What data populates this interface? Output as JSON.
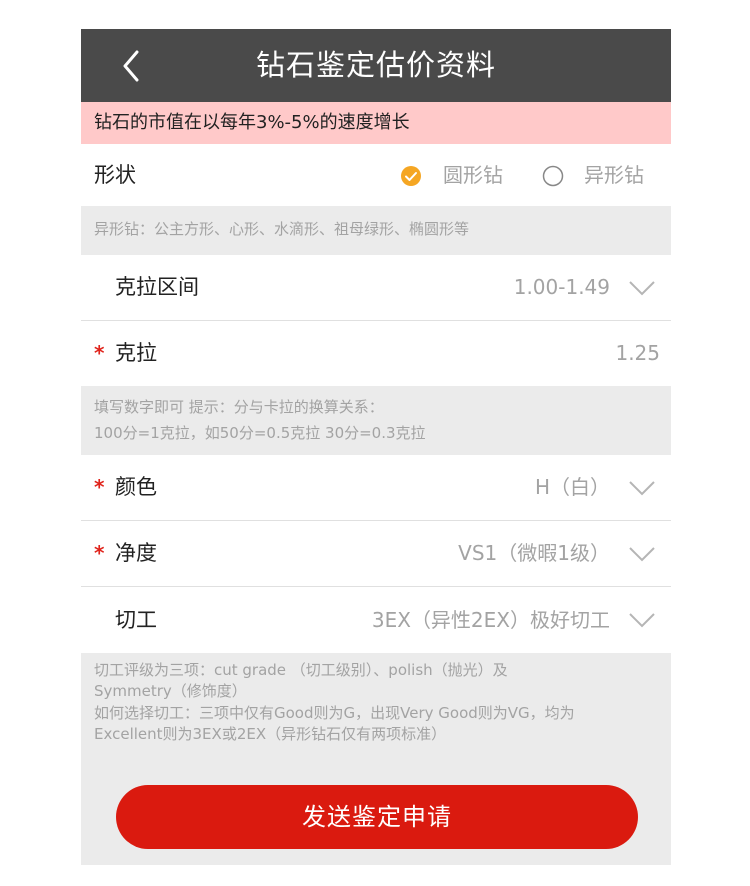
{
  "header": {
    "title": "钻石鉴定估价资料"
  },
  "banner": {
    "text": "钻石的市值在以每年3%-5%的速度增长"
  },
  "shape": {
    "label": "形状",
    "options": [
      {
        "label": "圆形钻",
        "selected": true
      },
      {
        "label": "异形钻",
        "selected": false
      }
    ],
    "hint": "异形钻：公主方形、心形、水滴形、祖母绿形、椭圆形等"
  },
  "carat_range": {
    "label": "克拉区间",
    "value": "1.00-1.49"
  },
  "carat": {
    "required_mark": "*",
    "label": "克拉",
    "value": "1.25",
    "hint_line1": "填写数字即可  提示：分与卡拉的换算关系：",
    "hint_line2": "100分=1克拉，如50分=0.5克拉 30分=0.3克拉"
  },
  "color": {
    "required_mark": "*",
    "label": "颜色",
    "value": "H（白）"
  },
  "clarity": {
    "required_mark": "*",
    "label": "净度",
    "value": "VS1（微暇1级）"
  },
  "cut": {
    "label": "切工",
    "value": "3EX（异性2EX）极好切工",
    "hint_lines": [
      "切工评级为三项：cut grade （切工级别）、polish（抛光）及",
      "Symmetry（修饰度）",
      "如何选择切工：三项中仅有Good则为G，出现Very Good则为VG，均为",
      "Excellent则为3EX或2EX（异形钻石仅有两项标准）"
    ]
  },
  "submit": {
    "label": "发送鉴定申请"
  },
  "colors": {
    "accent_orange": "#f5a623",
    "submit_red": "#da1a0f",
    "banner_pink": "#ffc9c9",
    "required_red": "#e0241c"
  },
  "icons": {
    "back": "back-chevron-icon",
    "dropdown": "chevron-down-icon",
    "radio_on": "radio-checked-icon",
    "radio_off": "radio-unchecked-icon"
  }
}
